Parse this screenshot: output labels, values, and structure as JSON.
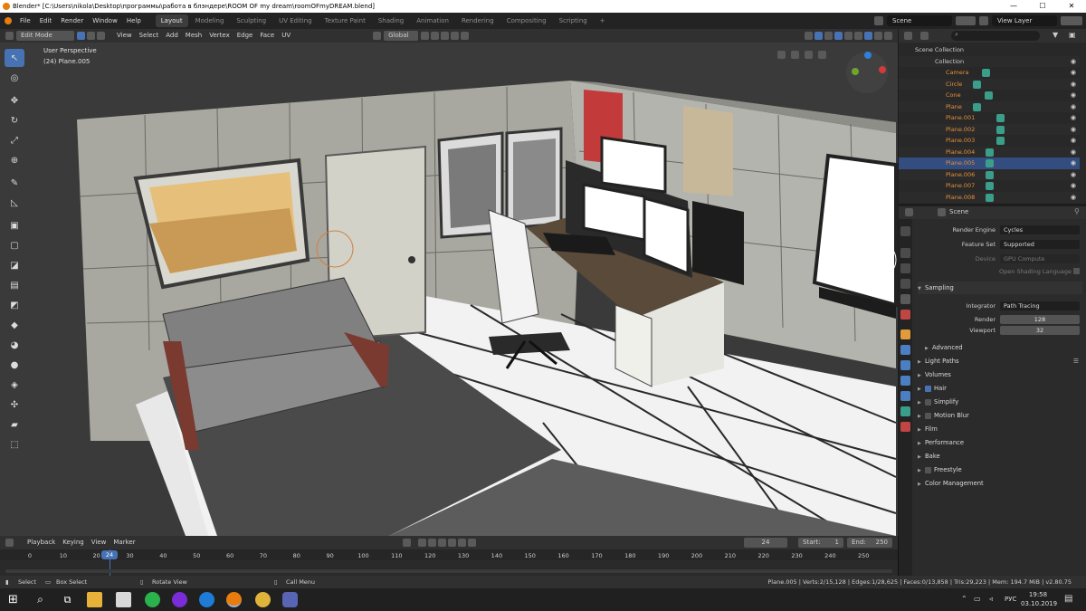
{
  "window": {
    "title": "Blender* [C:\\Users\\nikola\\Desktop\\программы\\работа в блэндере\\ROOM OF my dream\\roomOFmyDREAM.blend]",
    "controls": [
      "—",
      "☐",
      "✕"
    ]
  },
  "menubar": {
    "items": [
      "File",
      "Edit",
      "Render",
      "Window",
      "Help"
    ],
    "workspaces": [
      "Layout",
      "Modeling",
      "Sculpting",
      "UV Editing",
      "Texture Paint",
      "Shading",
      "Animation",
      "Rendering",
      "Compositing",
      "Scripting"
    ],
    "active_workspace": "Layout",
    "add_workspace": "+",
    "scene": "Scene",
    "view_layer": "View Layer"
  },
  "viewport_header": {
    "mode": "Edit Mode",
    "menus": [
      "View",
      "Select",
      "Add",
      "Mesh",
      "Vertex",
      "Edge",
      "Face",
      "UV"
    ],
    "orientation": "Global",
    "overlay_text_1": "User Perspective",
    "overlay_text_2": "(24) Plane.005"
  },
  "outliner": {
    "root": "Scene Collection",
    "collection": "Collection",
    "items": [
      "Camera",
      "Circle",
      "Cone",
      "Plane",
      "Plane.001",
      "Plane.002",
      "Plane.003",
      "Plane.004",
      "Plane.005",
      "Plane.006",
      "Plane.007",
      "Plane.008"
    ],
    "selected": "Plane.005"
  },
  "properties": {
    "header_label": "Scene",
    "render_engine_label": "Render Engine",
    "render_engine": "Cycles",
    "feature_set_label": "Feature Set",
    "feature_set": "Supported",
    "device_label": "Device",
    "device": "GPU Compute",
    "osl_label": "Open Shading Language",
    "sampling": "Sampling",
    "integrator_label": "Integrator",
    "integrator": "Path Tracing",
    "render_label": "Render",
    "render_samples": "128",
    "viewport_label": "Viewport",
    "viewport_samples": "32",
    "advanced": "Advanced",
    "panels": [
      "Light Paths",
      "Volumes",
      "Hair",
      "Simplify",
      "Motion Blur",
      "Film",
      "Performance",
      "Bake",
      "Freestyle",
      "Color Management"
    ]
  },
  "timeline": {
    "menus": [
      "Playback",
      "Keying",
      "View",
      "Marker"
    ],
    "current_frame": "24",
    "start_label": "Start:",
    "start": "1",
    "end_label": "End:",
    "end": "250",
    "ticks": [
      "0",
      "10",
      "20",
      "24",
      "30",
      "40",
      "50",
      "60",
      "70",
      "80",
      "90",
      "100",
      "110",
      "120",
      "130",
      "140",
      "150",
      "160",
      "170",
      "180",
      "190",
      "200",
      "210",
      "220",
      "230",
      "240",
      "250"
    ]
  },
  "statusbar": {
    "select": "Select",
    "box_select": "Box Select",
    "rotate_view": "Rotate View",
    "call_menu": "Call Menu",
    "stats": "Plane.005 | Verts:2/15,128 | Edges:1/28,625 | Faces:0/13,858 | Tris:29,223 | Mem: 194.7 MiB | v2.80.75"
  },
  "taskbar": {
    "language": "РУС",
    "time": "19:58",
    "date": "03.10.2019"
  },
  "colors": {
    "accent": "#4772b3",
    "orange": "#e8903a",
    "selected_row": "#334d80",
    "playhead": "#4772b3"
  }
}
